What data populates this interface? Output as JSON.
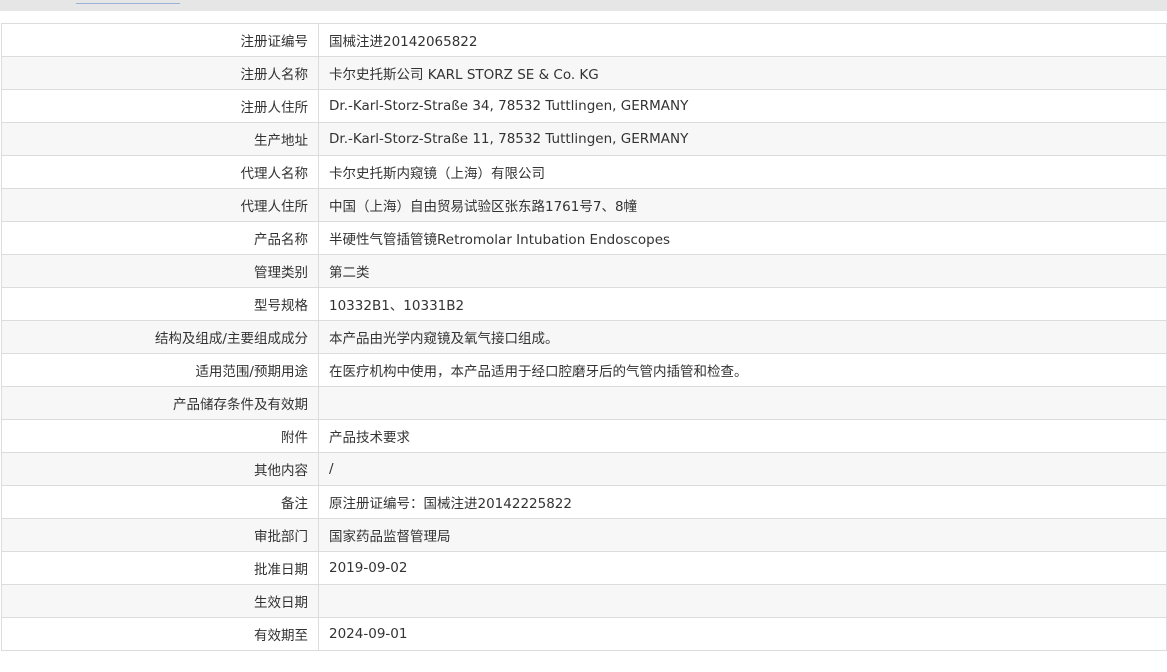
{
  "rows": [
    {
      "label": "注册证编号",
      "value": "国械注进20142065822"
    },
    {
      "label": "注册人名称",
      "value": "卡尔史托斯公司 KARL STORZ SE & Co. KG"
    },
    {
      "label": "注册人住所",
      "value": "Dr.-Karl-Storz-Straße 34, 78532 Tuttlingen, GERMANY"
    },
    {
      "label": "生产地址",
      "value": "Dr.-Karl-Storz-Straße 11, 78532 Tuttlingen, GERMANY"
    },
    {
      "label": "代理人名称",
      "value": "卡尔史托斯内窥镜（上海）有限公司"
    },
    {
      "label": "代理人住所",
      "value": "中国（上海）自由贸易试验区张东路1761号7、8幢"
    },
    {
      "label": "产品名称",
      "value": "半硬性气管插管镜Retromolar Intubation Endoscopes"
    },
    {
      "label": "管理类别",
      "value": "第二类"
    },
    {
      "label": "型号规格",
      "value": "10332B1、10331B2"
    },
    {
      "label": "结构及组成/主要组成成分",
      "value": "本产品由光学内窥镜及氧气接口组成。"
    },
    {
      "label": "适用范围/预期用途",
      "value": "在医疗机构中使用，本产品适用于经口腔磨牙后的气管内插管和检查。"
    },
    {
      "label": "产品储存条件及有效期",
      "value": ""
    },
    {
      "label": "附件",
      "value": "产品技术要求"
    },
    {
      "label": "其他内容",
      "value": "/"
    },
    {
      "label": "备注",
      "value": "原注册证编号：国械注进20142225822"
    },
    {
      "label": "审批部门",
      "value": "国家药品监督管理局"
    },
    {
      "label": "批准日期",
      "value": "2019-09-02"
    },
    {
      "label": "生效日期",
      "value": ""
    },
    {
      "label": "有效期至",
      "value": "2024-09-01"
    }
  ]
}
